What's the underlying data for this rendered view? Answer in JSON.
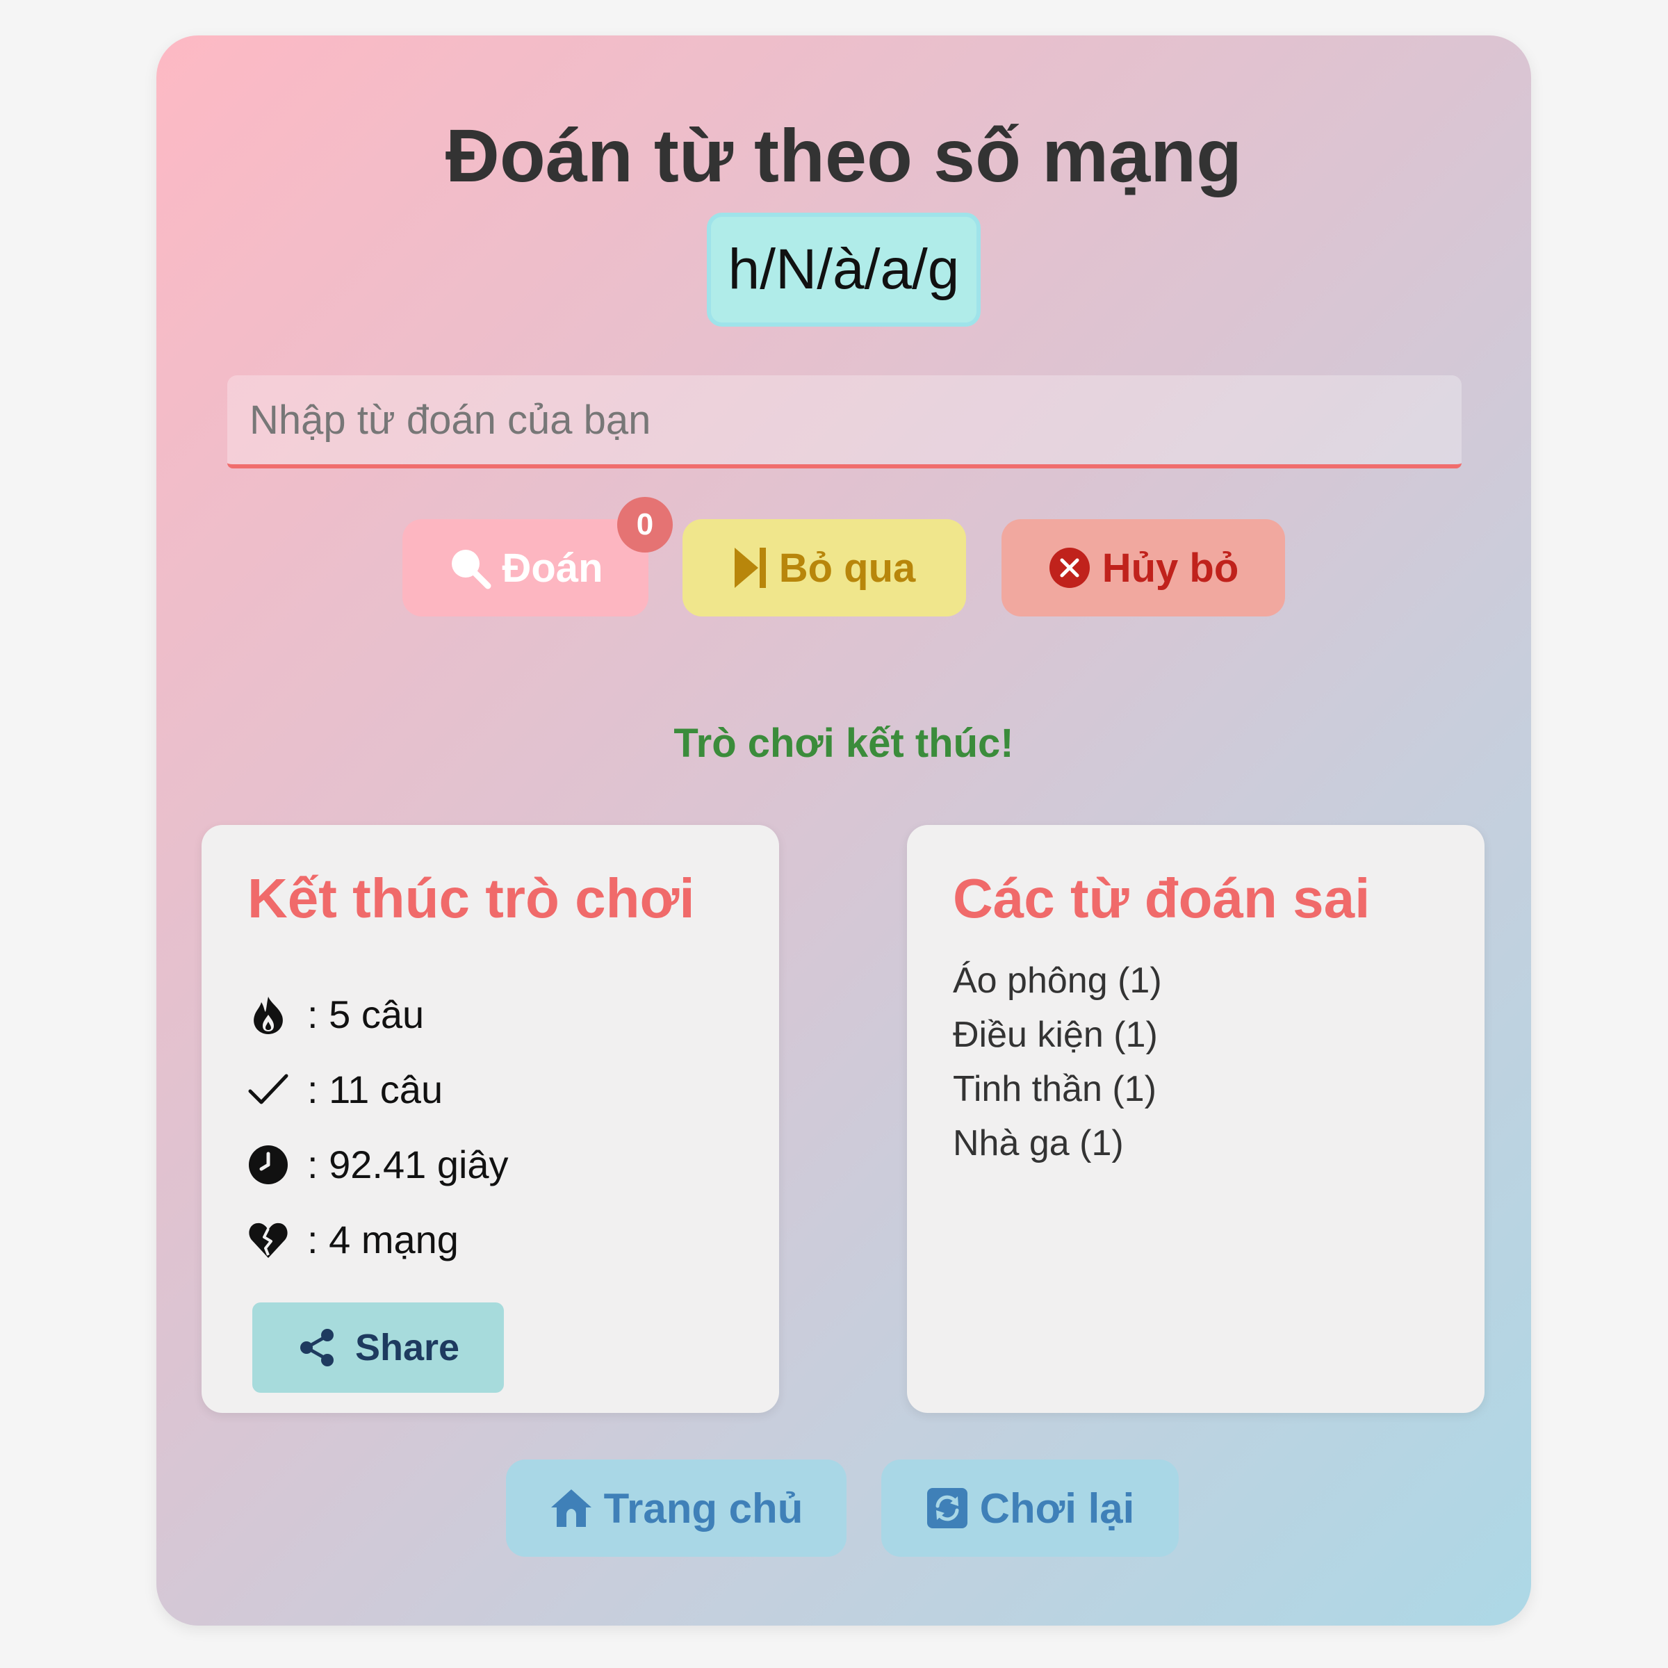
{
  "title": "Đoán từ theo số mạng",
  "puzzle": {
    "scrambled": "h/N/à/a/g"
  },
  "input": {
    "placeholder": "Nhập từ đoán của bạn"
  },
  "buttons": {
    "guess_label": "Đoán",
    "guess_badge": "0",
    "skip_label": "Bỏ qua",
    "cancel_label": "Hủy bỏ"
  },
  "status": "Trò chơi kết thúc!",
  "result": {
    "heading": "Kết thúc trò chơi",
    "stats": [
      {
        "icon": "fire-icon",
        "text": ": 5 câu"
      },
      {
        "icon": "check-icon",
        "text": ": 11 câu"
      },
      {
        "icon": "clock-icon",
        "text": ": 92.41 giây"
      },
      {
        "icon": "broken-heart-icon",
        "text": ": 4 mạng"
      }
    ],
    "share_label": "Share"
  },
  "wrong": {
    "heading": "Các từ đoán sai",
    "items": [
      "Áo phông (1)",
      "Điều kiện (1)",
      "Tinh thần (1)",
      "Nhà ga (1)"
    ]
  },
  "nav": {
    "home_label": "Trang chủ",
    "replay_label": "Chơi lại"
  },
  "colors": {
    "accent_red": "#f06a6a",
    "success_green": "#3b8c3b",
    "guess_button": "#fdb6c1",
    "skip_button": "#f0e68c",
    "cancel_button": "#f1a89f",
    "share_button": "#a7dbdc",
    "nav_button": "#a9d7e6"
  }
}
